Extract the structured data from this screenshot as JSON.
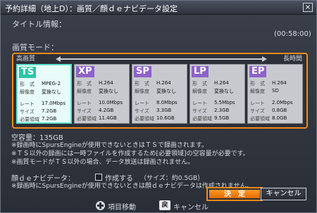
{
  "window": {
    "title": "予約詳細（地上D）：画質／顔ｄｅナビデータ設定",
    "close": "×"
  },
  "title_info": {
    "label": "タイトル情報：",
    "duration": "(00:58:00)"
  },
  "quality": {
    "label": "画質モード：",
    "high": "高画質",
    "long": "長時間",
    "modes": [
      {
        "code": "TS",
        "selected": true,
        "format_k": "形　式",
        "format_v": "MPEG-2",
        "res_k": "解像度",
        "res_v": "変換なし",
        "rate_k": "レート",
        "rate_v": "17.0Mbps",
        "size_k": "サイズ",
        "size_v": "7.2GB",
        "need_k": "必要領域",
        "need_v": "7.2GB"
      },
      {
        "code": "XP",
        "selected": false,
        "format_k": "形　式",
        "format_v": "H.264",
        "res_k": "解像度",
        "res_v": "変換なし",
        "rate_k": "レート",
        "rate_v": "10.0Mbps",
        "size_k": "サイズ",
        "size_v": "4.2GB",
        "need_k": "必要領域",
        "need_v": "11.4GB"
      },
      {
        "code": "SP",
        "selected": false,
        "format_k": "形　式",
        "format_v": "H.264",
        "res_k": "解像度",
        "res_v": "変換なし",
        "rate_k": "レート",
        "rate_v": "8.0Mbps",
        "size_k": "サイズ",
        "size_v": "3.3GB",
        "need_k": "必要領域",
        "need_v": "10.6GB"
      },
      {
        "code": "LP",
        "selected": false,
        "format_k": "形　式",
        "format_v": "H.264",
        "res_k": "解像度",
        "res_v": "変換なし",
        "rate_k": "レート",
        "rate_v": "5.5Mbps",
        "size_k": "サイズ",
        "size_v": "2.3GB",
        "need_k": "必要領域",
        "need_v": "9.5GB"
      },
      {
        "code": "EP",
        "selected": false,
        "format_k": "形　式",
        "format_v": "H.264",
        "res_k": "解像度",
        "res_v": "SD",
        "rate_k": "レート",
        "rate_v": "2.0Mbps",
        "size_k": "サイズ",
        "size_v": "0.8GB",
        "need_k": "必要領域",
        "need_v": "8.0GB"
      }
    ]
  },
  "free_space": {
    "label": "空容量：",
    "value": "135GB"
  },
  "notes": [
    "※録画時にSpursEngineが使用できないときはＴＳで録画されます。",
    "※ＴＳ以外の録画には一時ファイルを作成するため[必要領域]の空容量が必要です。",
    "※画質モードがＴＳ以外の場合、データ放送は録画されません。"
  ],
  "face_nav": {
    "label": "顔ｄｅナビデータ：",
    "checkbox_label": "作成する",
    "size": "（サイズ：約0.5GB）",
    "note": "※録画時にSpursEngineが使用できないときは顔ｄｅナビデータは作成されません。"
  },
  "buttons": {
    "ok": "決　定",
    "cancel": "キャンセル"
  },
  "bottom": {
    "move": "項目移動",
    "back_key": "戻る",
    "cancel": "キャンセル"
  },
  "colors": {
    "accent": "#f28a1a",
    "selected": "#2fc4a6",
    "badge": "#8e62c9"
  }
}
